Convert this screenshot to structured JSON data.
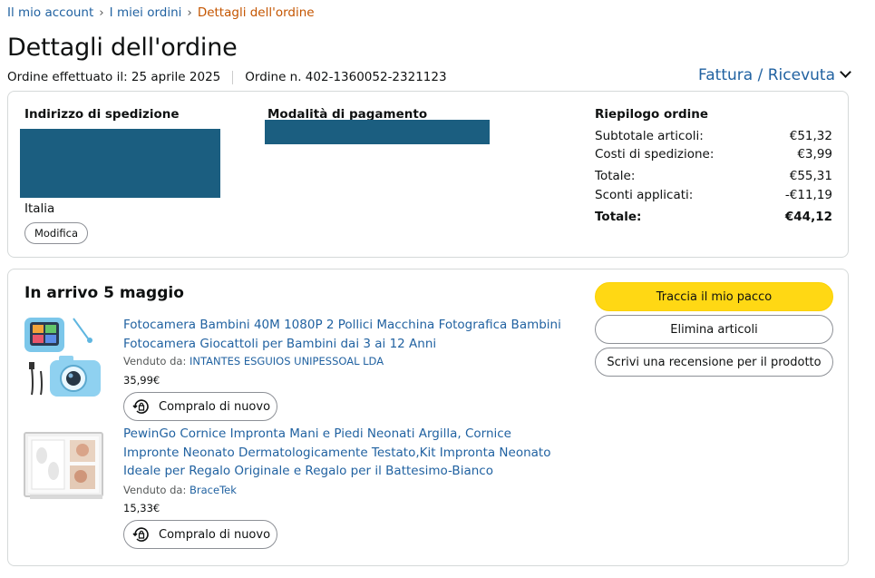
{
  "breadcrumb": {
    "account": "Il mio account",
    "orders": "I miei ordini",
    "current": "Dettagli dell'ordine"
  },
  "page_title": "Dettagli dell'ordine",
  "order_meta": {
    "placed": "Ordine effettuato il: 25 aprile 2025",
    "number": "Ordine n. 402-1360052-2321123"
  },
  "invoice_label": "Fattura / Ricevuta",
  "shipping": {
    "title": "Indirizzo di spedizione",
    "country": "Italia",
    "edit_label": "Modifica"
  },
  "payment": {
    "title": "Modalità di pagamento"
  },
  "summary": {
    "title": "Riepilogo ordine",
    "rows": [
      {
        "label": "Subtotale articoli:",
        "value": "€51,32"
      },
      {
        "label": "Costi di spedizione:",
        "value": "€3,99"
      },
      {
        "label": "Totale:",
        "value": "€55,31"
      },
      {
        "label": "Sconti applicati:",
        "value": "-€11,19"
      },
      {
        "label": "Totale:",
        "value": "€44,12"
      }
    ]
  },
  "shipment": {
    "arrival": "In arrivo 5 maggio",
    "actions": {
      "track": "Traccia il mio pacco",
      "delete": "Elimina articoli",
      "review": "Scrivi una recensione per il prodotto"
    },
    "items": [
      {
        "title": "Fotocamera Bambini 40M 1080P 2 Pollici Macchina Fotografica Bambini Fotocamera Giocattoli per Bambini dai 3 ai 12 Anni",
        "sold_by_label": "Venduto da:",
        "seller": "INTANTES ESGUIOS UNIPESSOAL LDA",
        "price": "35,99€",
        "buy_again": "Compralo di nuovo"
      },
      {
        "title": "PewinGo Cornice Impronta Mani e Piedi Neonati Argilla, Cornice Impronte Neonato Dermatologicamente Testato,Kit Impronta Neonato Ideale per Regalo Originale e Regalo per il Battesimo-Bianco",
        "sold_by_label": "Venduto da:",
        "seller": "BraceTek",
        "price": "15,33€",
        "buy_again": "Compralo di nuovo"
      }
    ]
  },
  "colors": {
    "link": "#2162a1",
    "breadcrumb_current": "#c45500",
    "primary_button": "#ffd814",
    "redaction": "#1b5e80"
  }
}
